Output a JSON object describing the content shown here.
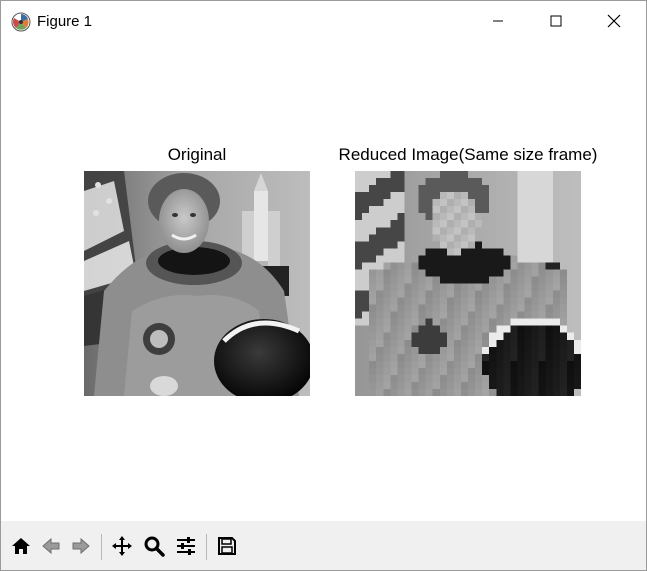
{
  "window": {
    "title": "Figure 1",
    "controls": [
      "minimize",
      "maximize",
      "close"
    ]
  },
  "figure": {
    "subplots": [
      {
        "title": "Original",
        "image": "grayscale portrait of astronaut in spacesuit with helmet, flag and shuttle model"
      },
      {
        "title": "Reduced Image(Same size frame)",
        "image": "pixelated low-resolution version of the same astronaut portrait"
      }
    ]
  },
  "toolbar": {
    "buttons": [
      {
        "name": "home-icon",
        "tooltip": "Reset original view"
      },
      {
        "name": "back-arrow-icon",
        "tooltip": "Back"
      },
      {
        "name": "forward-arrow-icon",
        "tooltip": "Forward"
      },
      {
        "name": "pan-icon",
        "tooltip": "Pan"
      },
      {
        "name": "zoom-icon",
        "tooltip": "Zoom"
      },
      {
        "name": "configure-subplots-icon",
        "tooltip": "Configure subplots"
      },
      {
        "name": "save-icon",
        "tooltip": "Save"
      }
    ]
  },
  "colors": {
    "toolbar_bg": "#f0f0f0",
    "window_bg": "#ffffff",
    "icon": "#000000"
  }
}
